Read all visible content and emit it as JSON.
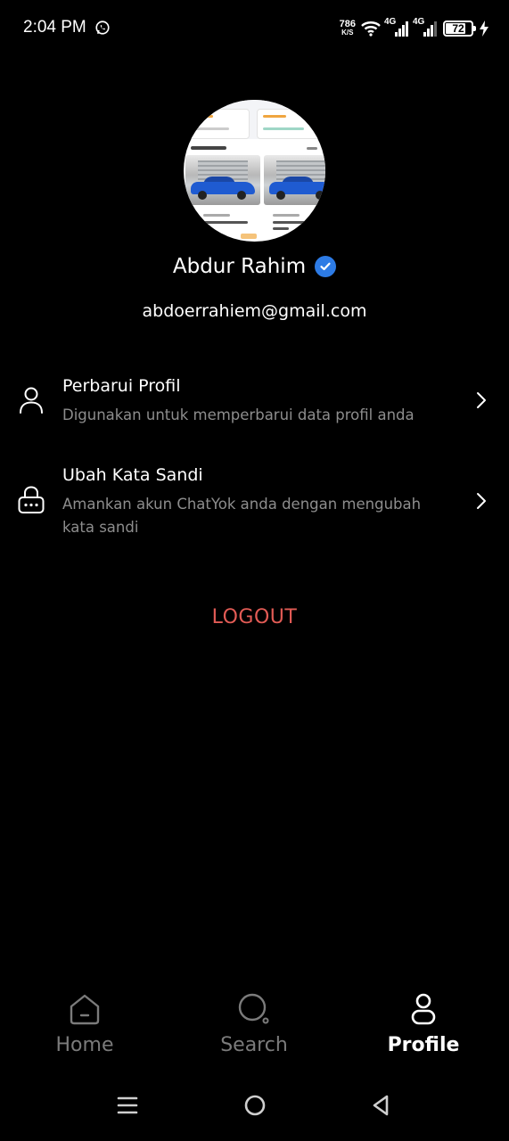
{
  "status_bar": {
    "time": "2:04 PM",
    "net_speed": "786",
    "net_unit": "K/S",
    "network_1": "4G",
    "network_2": "4G",
    "battery": "72",
    "icons": [
      "whatsapp-icon",
      "wifi-icon",
      "signal-icon",
      "battery-icon",
      "charging-icon"
    ]
  },
  "profile": {
    "name": "Abdur Rahim",
    "email": "abdoerrahiem@gmail.com",
    "verified_color": "#2d7be5"
  },
  "menu": [
    {
      "title": "Perbarui Profil",
      "description": "Digunakan untuk memperbarui data profil anda",
      "icon": "user-icon"
    },
    {
      "title": "Ubah Kata Sandi",
      "description": "Amankan akun ChatYok anda dengan mengubah kata sandi",
      "icon": "lock-icon"
    }
  ],
  "logout_label": "LOGOUT",
  "logout_color": "#e25b55",
  "bottom_nav": [
    {
      "label": "Home",
      "icon": "home-icon",
      "active": false
    },
    {
      "label": "Search",
      "icon": "search-icon",
      "active": false
    },
    {
      "label": "Profile",
      "icon": "profile-icon",
      "active": true
    }
  ],
  "system_nav": [
    "menu-icon",
    "home-circle-icon",
    "back-icon"
  ]
}
